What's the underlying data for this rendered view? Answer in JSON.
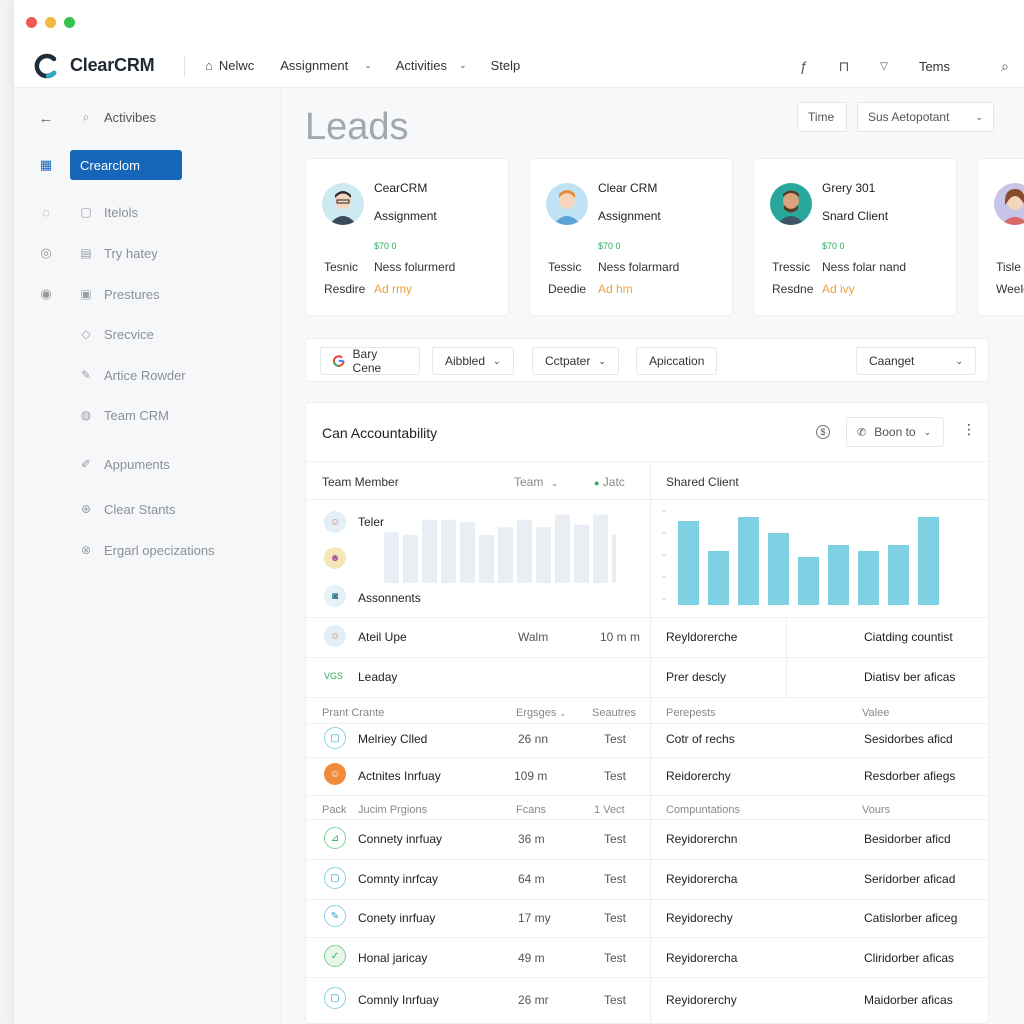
{
  "app": {
    "title": "ClearCRM",
    "window_controls": [
      "close",
      "minimize",
      "maximize"
    ],
    "colors": {
      "accent": "#1565b8",
      "chart": "#7fd0e3",
      "chart_ghost": "#e8eef3",
      "positive": "#2eaa5c",
      "warning": "#e8a33c"
    }
  },
  "topnav": {
    "items": [
      {
        "label": "Nelwc",
        "icon": "home-icon"
      },
      {
        "label": "Assignment",
        "icon": "chevron-down-icon"
      },
      {
        "label": "Activities",
        "icon": "chevron-down-icon"
      },
      {
        "label": "Stelp",
        "icon": ""
      }
    ],
    "right": {
      "label": "Tems"
    }
  },
  "sidebar": {
    "back_icon": "arrow-left-icon",
    "header_label": "Activibes",
    "active_label": "Crearclom",
    "items": [
      {
        "label": "Itelols",
        "icon": "document-icon"
      },
      {
        "label": "Try hatey",
        "icon": "chat-icon"
      },
      {
        "label": "Prestures",
        "icon": "board-icon"
      },
      {
        "label": "Srecvice",
        "icon": "tag-icon"
      },
      {
        "label": "Artice Rowder",
        "icon": "pencil-icon"
      },
      {
        "label": "Team CRM",
        "icon": "team-icon"
      },
      {
        "label": "Appuments",
        "icon": "edit-icon"
      },
      {
        "label": "Clear Stants",
        "icon": "clip-icon"
      },
      {
        "label": "Ergarl opecizations",
        "icon": "settings-icon"
      }
    ]
  },
  "main": {
    "title": "Leads",
    "time_label": "Time",
    "select_label": "Sus Aetopotant",
    "cards": [
      {
        "name": "CearCRM",
        "role": "Assignment",
        "amount": "$70 0",
        "row1_key": "Tesnic",
        "row1_value": "Ness folurmerd",
        "row2_key": "Resdire",
        "row2_value": "Ad rmy"
      },
      {
        "name": "Clear CRM",
        "role": "Assignment",
        "amount": "$70 0",
        "row1_key": "Tessic",
        "row1_value": "Ness folarmard",
        "row2_key": "Deedie",
        "row2_value": "Ad hm"
      },
      {
        "name": "Grery 301",
        "role": "Snard Client",
        "amount": "$70 0",
        "row1_key": "Tressic",
        "row1_value": "Ness folar nand",
        "row2_key": "Resdne",
        "row2_value": "Ad ivy"
      },
      {
        "name": "",
        "role": "",
        "amount": "",
        "row1_key": "Tisle",
        "row1_value": "",
        "row2_key": "Weelc",
        "row2_value": ""
      }
    ],
    "filters": {
      "search": "Bary Cene",
      "f1": "Aibbled",
      "f2": "Cctpater",
      "f3": "Apiccation",
      "f4": "Caanget"
    }
  },
  "panel": {
    "title": "Can Accountability",
    "action_label": "Boon to",
    "headers": {
      "member": "Team Member",
      "team": "Team",
      "status": "Jatc",
      "shared": "Shared Client"
    },
    "left_list": [
      {
        "name": "Teler"
      },
      {
        "name": ""
      },
      {
        "name": "Assonnents"
      }
    ],
    "rows_a": [
      {
        "name": "Ateil Upe",
        "c1": "Walm",
        "c2": "10 m m",
        "c3": "Reyldorerche",
        "c4": "Ciatding countist"
      },
      {
        "name": "Leaday",
        "icon_text": "VGS",
        "c1": "",
        "c2": "",
        "c3": "Prer descly",
        "c4": "Diatisv ber aficas"
      }
    ],
    "subhead_1": {
      "a": "Prant Crante",
      "b": "Ergsges",
      "c": "Seautres",
      "d": "Perepests",
      "e": "Valee"
    },
    "rows_b": [
      {
        "name": "Melriey Clled",
        "c1": "26 nn",
        "c2": "Test",
        "c3": "Cotr of rechs",
        "c4": "Sesidorbes aficd"
      },
      {
        "name": "Actnites Inrfuay",
        "c1": "109 m",
        "c2": "Test",
        "c3": "Reidorerchy",
        "c4": "Resdorber afiegs"
      }
    ],
    "subhead_2": {
      "a": "Pack",
      "a2": "Jucim Prgions",
      "b": "Fcans",
      "c": "1 Vect",
      "d": "Compuntations",
      "e": "Vours"
    },
    "rows_c": [
      {
        "name": "Connety inrfuay",
        "c1": "36 m",
        "c2": "Test",
        "c3": "Reyidorerchn",
        "c4": "Besidorber aficd"
      },
      {
        "name": "Comnty inrfcay",
        "c1": "64 m",
        "c2": "Test",
        "c3": "Reyidorercha",
        "c4": "Seridorber aficad"
      },
      {
        "name": "Conety inrfuay",
        "c1": "17 my",
        "c2": "Test",
        "c3": "Reyidorechy",
        "c4": "Catislorber aficeg"
      },
      {
        "name": "Honal jaricay",
        "c1": "49 m",
        "c2": "Test",
        "c3": "Reyidorercha",
        "c4": "Cliridorber aficas"
      },
      {
        "name": "Comnly Inrfuay",
        "c1": "26 mr",
        "c2": "Test",
        "c3": "Reyidorerchy",
        "c4": "Maidorber aficas"
      }
    ]
  },
  "chart_data": [
    {
      "type": "bar",
      "series": [
        {
          "values": [
            40,
            38,
            50,
            50,
            48,
            38,
            44,
            50,
            44,
            54,
            46,
            54,
            38
          ]
        }
      ],
      "ylim": [
        0,
        60
      ]
    },
    {
      "type": "bar",
      "series": [
        {
          "values": [
            84,
            54,
            88,
            72,
            48,
            60,
            54,
            60,
            88
          ]
        }
      ],
      "ylim": [
        0,
        100
      ]
    }
  ]
}
